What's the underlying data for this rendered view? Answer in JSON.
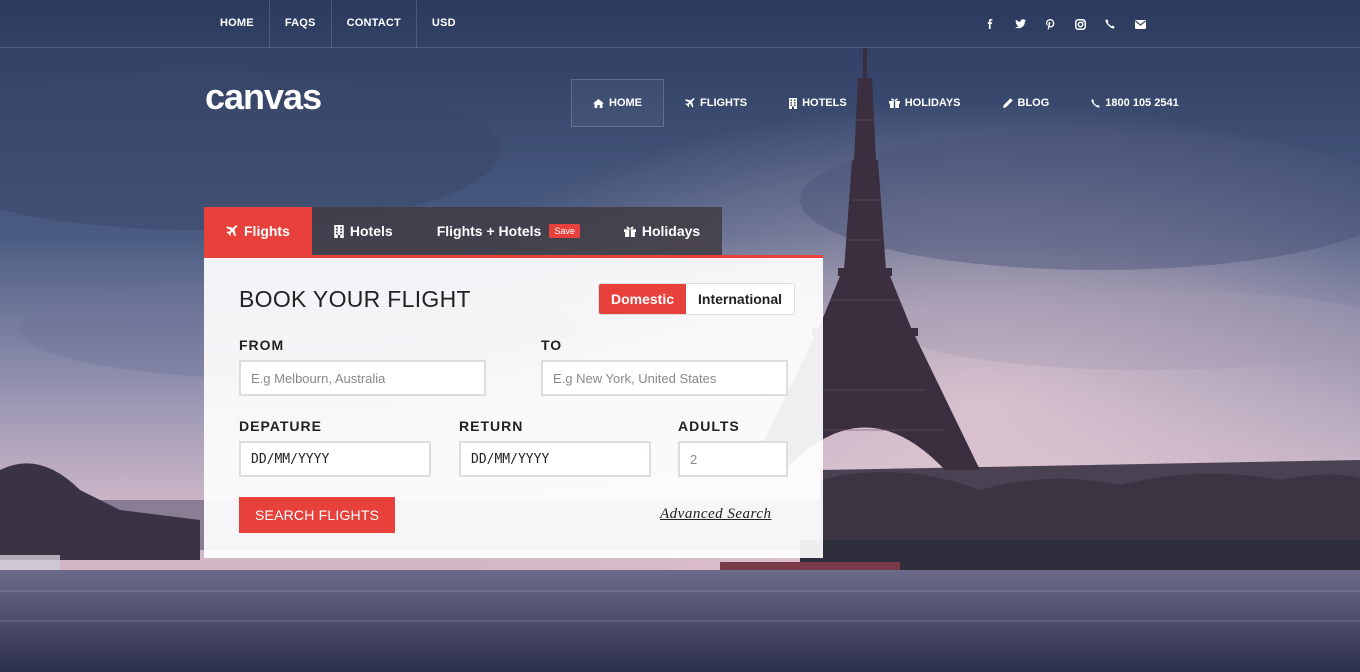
{
  "topbar": {
    "links": [
      "HOME",
      "FAQS",
      "CONTACT",
      "USD"
    ],
    "social_icons": [
      "facebook-icon",
      "twitter-icon",
      "pinterest-icon",
      "instagram-icon",
      "phone-icon",
      "envelope-icon"
    ]
  },
  "header": {
    "logo": "canvas",
    "nav": [
      {
        "label": "HOME",
        "icon": "home-icon",
        "active": true
      },
      {
        "label": "FLIGHTS",
        "icon": "plane-icon"
      },
      {
        "label": "HOTELS",
        "icon": "building-icon"
      },
      {
        "label": "HOLIDAYS",
        "icon": "gift-icon"
      },
      {
        "label": "BLOG",
        "icon": "pencil-icon"
      },
      {
        "label": "1800 105 2541",
        "icon": "phone-icon"
      }
    ]
  },
  "booking": {
    "tabs": [
      {
        "label": "Flights",
        "icon": "plane-icon",
        "active": true
      },
      {
        "label": "Hotels",
        "icon": "building-icon"
      },
      {
        "label": "Flights + Hotels",
        "badge": "Save"
      },
      {
        "label": "Holidays",
        "icon": "gift-icon"
      }
    ],
    "title": "BOOK YOUR FLIGHT",
    "trip_type": {
      "options": [
        "Domestic",
        "International"
      ],
      "selected": "Domestic"
    },
    "from": {
      "label": "FROM",
      "placeholder": "E.g Melbourn, Australia"
    },
    "to": {
      "label": "TO",
      "placeholder": "E.g New York, United States"
    },
    "departure": {
      "label": "DEPATURE",
      "value": "DD/MM/YYYY"
    },
    "return": {
      "label": "RETURN",
      "value": "DD/MM/YYYY"
    },
    "adults": {
      "label": "ADULTS",
      "placeholder": "2"
    },
    "search_button": "SEARCH FLIGHTS",
    "advanced_link": "Advanced Search"
  },
  "colors": {
    "accent": "#e8413b",
    "tab_dark": "#423c46"
  }
}
